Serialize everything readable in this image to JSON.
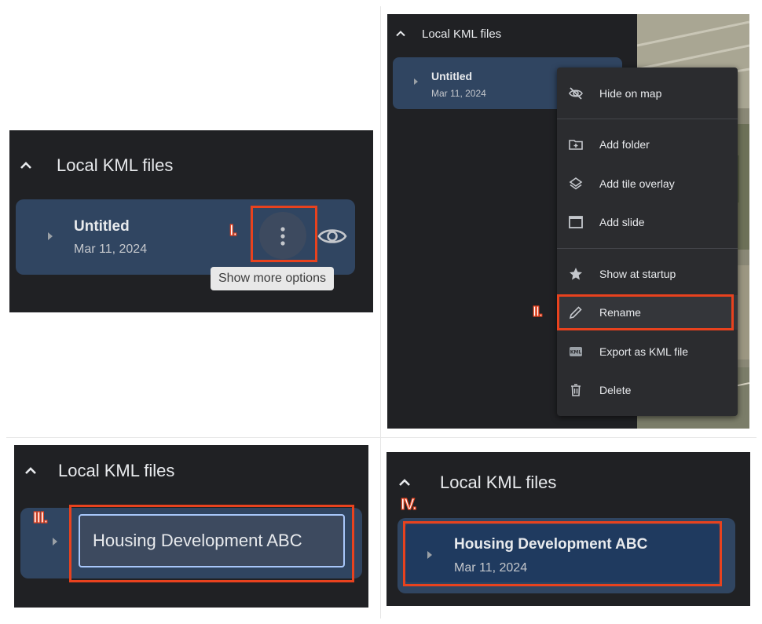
{
  "section_title": "Local KML files",
  "item": {
    "title": "Untitled",
    "date": "Mar 11, 2024"
  },
  "renamed_item": {
    "title": "Housing Development ABC",
    "date": "Mar 11, 2024"
  },
  "rename_input_value": "Housing Development ABC",
  "tooltip": "Show more options",
  "markers": {
    "one": "I.",
    "two": "II.",
    "three": "III.",
    "four": "IV."
  },
  "menu": {
    "items": [
      {
        "label": "Hide on map",
        "icon": "eye-off-icon"
      },
      {
        "label": "Add folder",
        "icon": "folder-plus-icon"
      },
      {
        "label": "Add tile overlay",
        "icon": "layers-icon"
      },
      {
        "label": "Add slide",
        "icon": "slide-icon"
      },
      {
        "label": "Show at startup",
        "icon": "star-icon"
      },
      {
        "label": "Rename",
        "icon": "pencil-icon"
      },
      {
        "label": "Export as KML file",
        "icon": "kml-icon"
      },
      {
        "label": "Delete",
        "icon": "trash-icon"
      }
    ]
  },
  "colors": {
    "panel_bg": "#202124",
    "card_bg": "#304561",
    "selected_card_bg": "#1f3a5f",
    "highlight": "#e8421e",
    "menu_bg": "#2b2c2f"
  }
}
